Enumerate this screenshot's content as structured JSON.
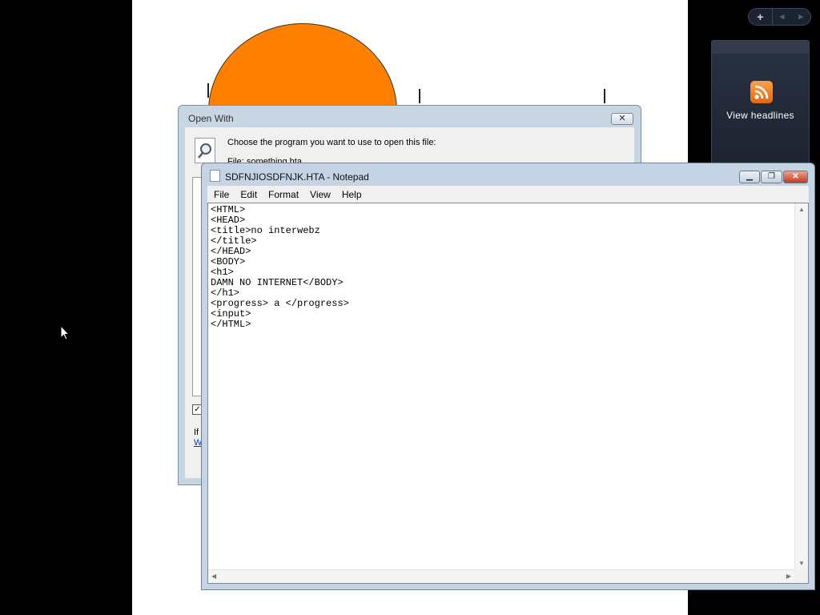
{
  "open_with": {
    "title": "Open With",
    "choose_text": "Choose the program you want to use to open this file:",
    "file_line": "File:     something.hta",
    "if_text": "If",
    "link_text": "W"
  },
  "notepad": {
    "title": "SDFNJIOSDFNJK.HTA - Notepad",
    "menu": [
      "File",
      "Edit",
      "Format",
      "View",
      "Help"
    ],
    "content": "<HTML>\n<HEAD>\n<title>no interwebz\n</title>\n</HEAD>\n<BODY>\n<h1>\nDAMN NO INTERNET</BODY>\n</h1>\n<progress> a </progress>\n<input>\n</HTML>"
  },
  "gadget": {
    "add_label": "+",
    "prev_label": "◂",
    "next_label": "▸",
    "label": "View headlines"
  },
  "colors": {
    "accent_orange": "#ff8000",
    "desktop": "#000000"
  }
}
